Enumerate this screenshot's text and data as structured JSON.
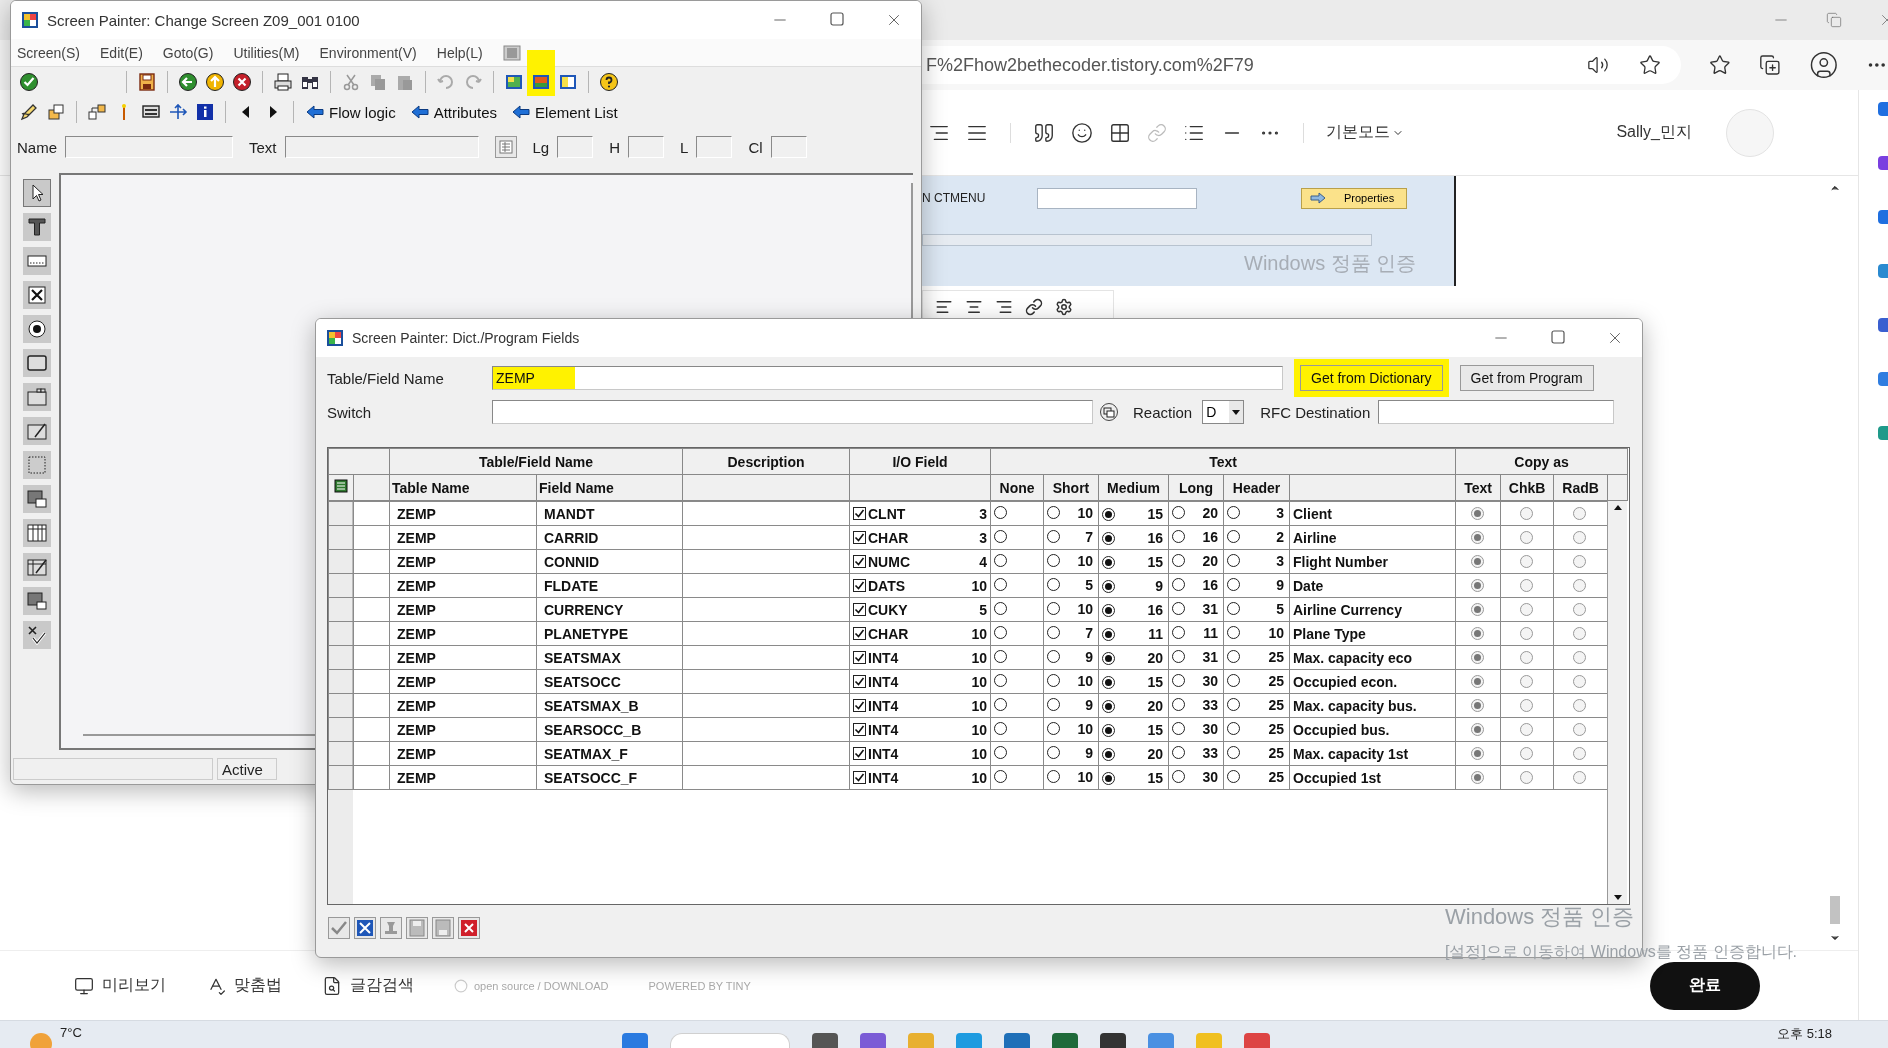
{
  "browser": {
    "address": "F%2Fhow2bethecoder.tistory.com%2F79",
    "mode_menu": "기본모드",
    "user_name": "Sally_민지",
    "embedded_screenshot": {
      "label": "N CTMENU",
      "button": "Properties",
      "watermark": "Windows 정품 인증"
    },
    "bottom_bar": {
      "items": [
        "미리보기",
        "맞춤법",
        "글감검색"
      ],
      "credits": [
        "open source / DOWNLOAD",
        "POWERED BY TINY"
      ],
      "done_button": "완료"
    },
    "watermark": [
      "Windows 정품 인증",
      "[설정]으로 이동하여 Windows를 정품 인증합니다."
    ]
  },
  "taskbar": {
    "weather": "7°C",
    "clock": "오후 5:18"
  },
  "sap_window": {
    "title": "Screen Painter:  Change Screen Z09_001 0100",
    "menu": [
      "Screen(S)",
      "Edit(E)",
      "Goto(G)",
      "Utilities(M)",
      "Environment(V)",
      "Help(L)"
    ],
    "layout_icon_highlighted": true,
    "nav_buttons": [
      "Flow logic",
      "Attributes",
      "Element List"
    ],
    "fields": [
      {
        "label": "Name",
        "kind": "wide"
      },
      {
        "label": "Text",
        "kind": "wide"
      },
      {
        "label": "Lg",
        "kind": "short"
      },
      {
        "label": "H",
        "kind": "short"
      },
      {
        "label": "L",
        "kind": "short"
      },
      {
        "label": "Cl",
        "kind": "short"
      }
    ],
    "status": "Active"
  },
  "dialog": {
    "title": "Screen Painter: Dict./Program Fields",
    "name_field": {
      "label": "Table/Field Name",
      "value": "ZEMP",
      "highlighted": true
    },
    "buttons": [
      {
        "label": "Get from Dictionary",
        "highlighted": true
      },
      {
        "label": "Get from Program",
        "highlighted": false
      }
    ],
    "switch_field": {
      "label": "Switch"
    },
    "reaction": {
      "label": "Reaction",
      "value": "D"
    },
    "rfc_field": {
      "label": "RFC Destination"
    },
    "table": {
      "groups": [
        "Table/Field Name",
        "Description",
        "I/O Field",
        "Text",
        "Copy as"
      ],
      "columns": [
        "Table Name",
        "Field Name",
        "None",
        "Short",
        "Medium",
        "Long",
        "Header",
        "Text",
        "ChkB",
        "RadB"
      ],
      "rows": [
        {
          "table": "ZEMP",
          "field": "MANDT",
          "io_field": true,
          "type": "CLNT",
          "length": "3",
          "text_options": [
            {
              "selected": false
            },
            {
              "value": "10",
              "selected": false
            },
            {
              "value": "15",
              "selected": true
            },
            {
              "value": "20",
              "selected": false
            },
            {
              "value": "3",
              "selected": false
            }
          ],
          "text": "Client",
          "copy_as": [
            {
              "selected": true
            },
            {
              "selected": false
            },
            {
              "selected": false
            }
          ]
        },
        {
          "table": "ZEMP",
          "field": "CARRID",
          "io_field": true,
          "type": "CHAR",
          "length": "3",
          "text_options": [
            {
              "selected": false
            },
            {
              "value": "7",
              "selected": false
            },
            {
              "value": "16",
              "selected": true
            },
            {
              "value": "16",
              "selected": false
            },
            {
              "value": "2",
              "selected": false
            }
          ],
          "text": "Airline",
          "copy_as": [
            {
              "selected": true
            },
            {
              "selected": false
            },
            {
              "selected": false
            }
          ]
        },
        {
          "table": "ZEMP",
          "field": "CONNID",
          "io_field": true,
          "type": "NUMC",
          "length": "4",
          "text_options": [
            {
              "selected": false
            },
            {
              "value": "10",
              "selected": false
            },
            {
              "value": "15",
              "selected": true
            },
            {
              "value": "20",
              "selected": false
            },
            {
              "value": "3",
              "selected": false
            }
          ],
          "text": "Flight Number",
          "copy_as": [
            {
              "selected": true
            },
            {
              "selected": false
            },
            {
              "selected": false
            }
          ]
        },
        {
          "table": "ZEMP",
          "field": "FLDATE",
          "io_field": true,
          "type": "DATS",
          "length": "10",
          "text_options": [
            {
              "selected": false
            },
            {
              "value": "5",
              "selected": false
            },
            {
              "value": "9",
              "selected": true
            },
            {
              "value": "16",
              "selected": false
            },
            {
              "value": "9",
              "selected": false
            }
          ],
          "text": "Date",
          "copy_as": [
            {
              "selected": true
            },
            {
              "selected": false
            },
            {
              "selected": false
            }
          ]
        },
        {
          "table": "ZEMP",
          "field": "CURRENCY",
          "io_field": true,
          "type": "CUKY",
          "length": "5",
          "text_options": [
            {
              "selected": false
            },
            {
              "value": "10",
              "selected": false
            },
            {
              "value": "16",
              "selected": true
            },
            {
              "value": "31",
              "selected": false
            },
            {
              "value": "5",
              "selected": false
            }
          ],
          "text": "Airline Currency",
          "copy_as": [
            {
              "selected": true
            },
            {
              "selected": false
            },
            {
              "selected": false
            }
          ]
        },
        {
          "table": "ZEMP",
          "field": "PLANETYPE",
          "io_field": true,
          "type": "CHAR",
          "length": "10",
          "text_options": [
            {
              "selected": false
            },
            {
              "value": "7",
              "selected": false
            },
            {
              "value": "11",
              "selected": true
            },
            {
              "value": "11",
              "selected": false
            },
            {
              "value": "10",
              "selected": false
            }
          ],
          "text": "Plane Type",
          "copy_as": [
            {
              "selected": true
            },
            {
              "selected": false
            },
            {
              "selected": false
            }
          ]
        },
        {
          "table": "ZEMP",
          "field": "SEATSMAX",
          "io_field": true,
          "type": "INT4",
          "length": "10",
          "text_options": [
            {
              "selected": false
            },
            {
              "value": "9",
              "selected": false
            },
            {
              "value": "20",
              "selected": true
            },
            {
              "value": "31",
              "selected": false
            },
            {
              "value": "25",
              "selected": false
            }
          ],
          "text": "Max. capacity eco",
          "copy_as": [
            {
              "selected": true
            },
            {
              "selected": false
            },
            {
              "selected": false
            }
          ]
        },
        {
          "table": "ZEMP",
          "field": "SEATSOCC",
          "io_field": true,
          "type": "INT4",
          "length": "10",
          "text_options": [
            {
              "selected": false
            },
            {
              "value": "10",
              "selected": false
            },
            {
              "value": "15",
              "selected": true
            },
            {
              "value": "30",
              "selected": false
            },
            {
              "value": "25",
              "selected": false
            }
          ],
          "text": "Occupied econ.",
          "copy_as": [
            {
              "selected": true
            },
            {
              "selected": false
            },
            {
              "selected": false
            }
          ]
        },
        {
          "table": "ZEMP",
          "field": "SEATSMAX_B",
          "io_field": true,
          "type": "INT4",
          "length": "10",
          "text_options": [
            {
              "selected": false
            },
            {
              "value": "9",
              "selected": false
            },
            {
              "value": "20",
              "selected": true
            },
            {
              "value": "33",
              "selected": false
            },
            {
              "value": "25",
              "selected": false
            }
          ],
          "text": "Max. capacity bus.",
          "copy_as": [
            {
              "selected": true
            },
            {
              "selected": false
            },
            {
              "selected": false
            }
          ]
        },
        {
          "table": "ZEMP",
          "field": "SEARSOCC_B",
          "io_field": true,
          "type": "INT4",
          "length": "10",
          "text_options": [
            {
              "selected": false
            },
            {
              "value": "10",
              "selected": false
            },
            {
              "value": "15",
              "selected": true
            },
            {
              "value": "30",
              "selected": false
            },
            {
              "value": "25",
              "selected": false
            }
          ],
          "text": "Occupied bus.",
          "copy_as": [
            {
              "selected": true
            },
            {
              "selected": false
            },
            {
              "selected": false
            }
          ]
        },
        {
          "table": "ZEMP",
          "field": "SEATMAX_F",
          "io_field": true,
          "type": "INT4",
          "length": "10",
          "text_options": [
            {
              "selected": false
            },
            {
              "value": "9",
              "selected": false
            },
            {
              "value": "20",
              "selected": true
            },
            {
              "value": "33",
              "selected": false
            },
            {
              "value": "25",
              "selected": false
            }
          ],
          "text": "Max. capacity 1st",
          "copy_as": [
            {
              "selected": true
            },
            {
              "selected": false
            },
            {
              "selected": false
            }
          ]
        },
        {
          "table": "ZEMP",
          "field": "SEATSOCC_F",
          "io_field": true,
          "type": "INT4",
          "length": "10",
          "text_options": [
            {
              "selected": false
            },
            {
              "value": "10",
              "selected": false
            },
            {
              "value": "15",
              "selected": true
            },
            {
              "value": "30",
              "selected": false
            },
            {
              "value": "25",
              "selected": false
            }
          ],
          "text": "Occupied 1st",
          "copy_as": [
            {
              "selected": true
            },
            {
              "selected": false
            },
            {
              "selected": false
            }
          ]
        }
      ]
    }
  }
}
